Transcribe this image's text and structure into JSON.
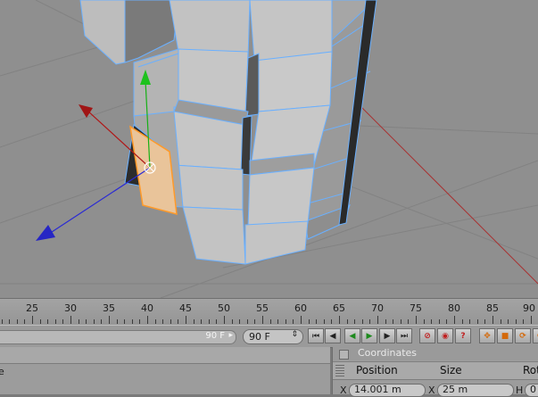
{
  "timeline": {
    "ruler_labels": [
      "25",
      "30",
      "35",
      "40",
      "45",
      "50",
      "55",
      "60",
      "65",
      "70",
      "75",
      "80",
      "85",
      "90"
    ]
  },
  "transport": {
    "frame_slider_label": "90 F",
    "frame_slider_arrow": "▸",
    "max_frame_value": "90 F",
    "max_frame_spinner": "⇕",
    "buttons": {
      "go_start": "⏮",
      "prev_key": "◀",
      "play_back": "◀",
      "play_fwd": "▶",
      "next_key": "▶",
      "go_end": "⏭",
      "record": "⊘",
      "autokey": "◉",
      "keyframe_help": "?",
      "move_tool": "✥",
      "scale_tool": "■",
      "rotate_tool": "⟳",
      "param_tool": "⟳"
    }
  },
  "left_panel": {
    "header_label": "e"
  },
  "coordinates": {
    "title": "Coordinates",
    "columns": {
      "position": "Position",
      "size": "Size",
      "rotation": "Rot"
    },
    "row_x": {
      "pos_axis": "X",
      "pos_value": "14.001 m",
      "size_axis": "X",
      "size_value": "25 m",
      "rot_axis": "H",
      "rot_value": "0"
    }
  },
  "colors": {
    "viewport_bg": "#8f8f8f",
    "selection_edge": "#6ab0ff",
    "selected_face": "#e9c49a",
    "axis_x": "#b01818",
    "axis_y": "#16b016",
    "axis_z": "#2424c8"
  }
}
